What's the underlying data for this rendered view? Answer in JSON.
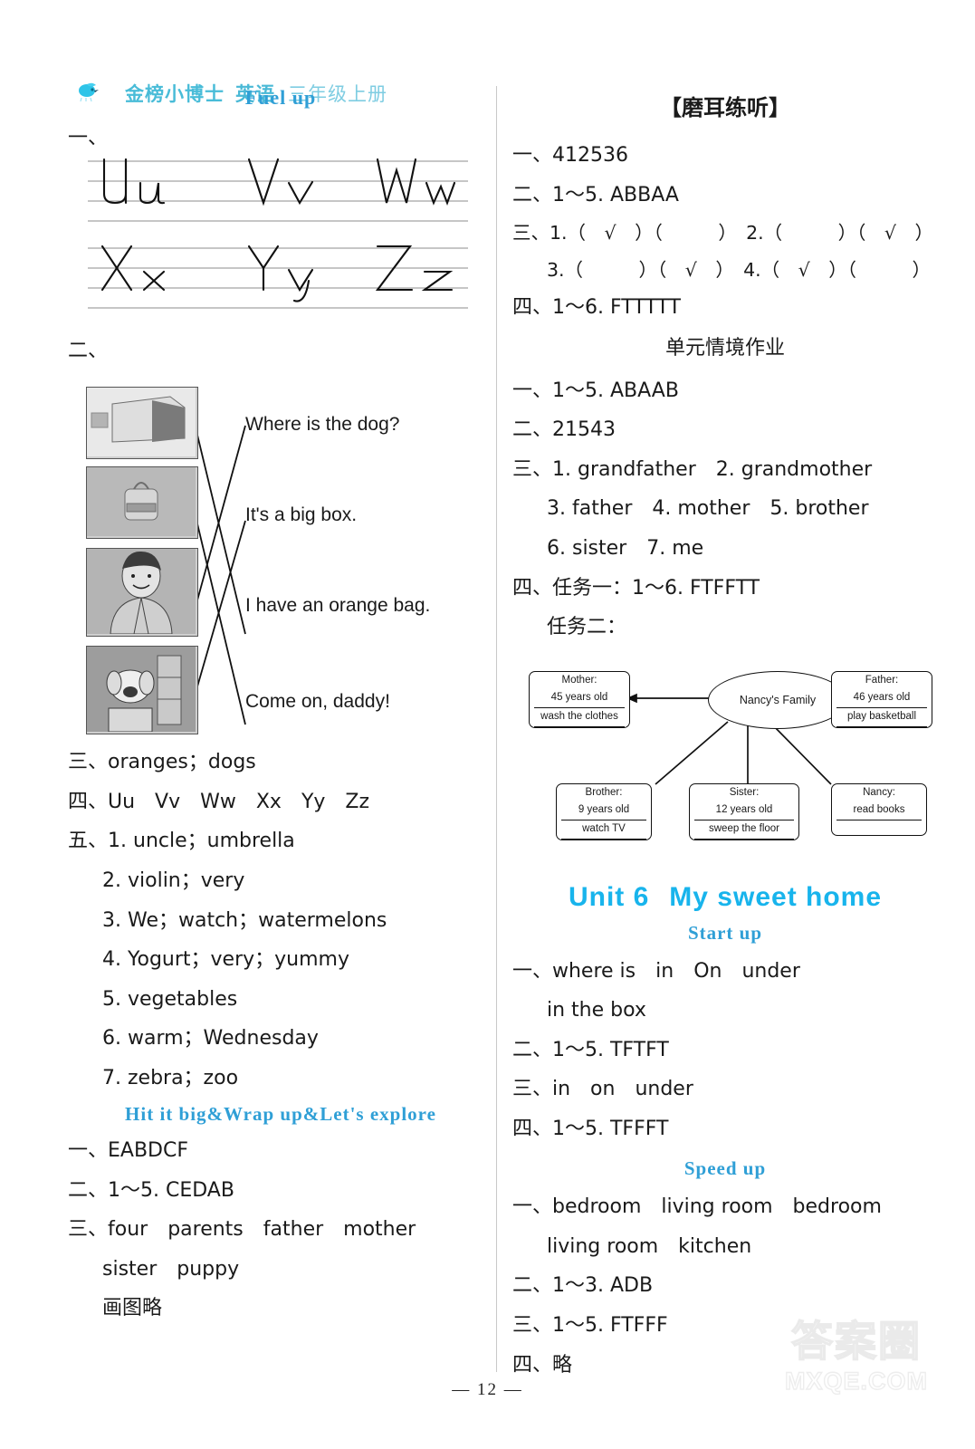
{
  "header": {
    "logo_icon": "bird-logo-icon",
    "brand": "金榜小博士",
    "subject": "英语",
    "grade": "三年级上册"
  },
  "page_footer": {
    "page_number": "— 12 —",
    "watermark_cn": "答案圈",
    "watermark_en": "MXQE.COM"
  },
  "left_column": {
    "section_title": "Fuel up",
    "q1": {
      "marker": "一、",
      "rows": [
        {
          "letters": [
            "Uu",
            "Vv",
            "Ww"
          ]
        },
        {
          "letters": [
            "Xx",
            "Yy",
            "Zz"
          ]
        }
      ]
    },
    "q2": {
      "marker": "二、",
      "pictures": [
        "big-box-photo",
        "orange-backpack-photo",
        "dad-illustration",
        "dog-in-kitchen-photo"
      ],
      "sentences": [
        "Where is the dog?",
        "It's a big box.",
        "I have an orange bag.",
        "Come on, daddy!"
      ]
    },
    "q3": "三、oranges；dogs",
    "q4": "四、Uu　Vv　Ww　Xx　Yy　Zz",
    "q5": {
      "marker": "五、",
      "items": [
        "1. uncle；umbrella",
        "2. violin；very",
        "3. We；watch；watermelons",
        "4. Yogurt；very；yummy",
        "5. vegetables",
        "6. warm；Wednesday",
        "7. zebra；zoo"
      ]
    },
    "section2_title": "Hit it big&Wrap up&Let's explore",
    "s2_q1": "一、EABDCF",
    "s2_q2": "二、1～5. CEDAB",
    "s2_q3_line1": "三、four　parents　father　mother",
    "s2_q3_line2": "sister　puppy",
    "s2_q3_line3": "画图略"
  },
  "right_column": {
    "listening_title": "【磨耳练听】",
    "l_q1": "一、412536",
    "l_q2": "二、1～5. ABBAA",
    "l_q3_line1": "三、1.（　√　）（　　　）　2.（　　　）（　√　）",
    "l_q3_line2": "3.（　　　）（　√　）　4.（　√　）（　　　）",
    "l_q4": "四、1～6. FTTTTT",
    "unit_task_title": "单元情境作业",
    "t_q1": "一、1～5. ABAAB",
    "t_q2": "二、21543",
    "t_q3_line1": "三、1. grandfather　2. grandmother",
    "t_q3_line2": "3. father　4. mother　5. brother",
    "t_q3_line3": "6. sister　7. me",
    "t_q4_line1": "四、任务一：1～6. FTFFTT",
    "t_q4_line2": "任务二：",
    "family_chart": {
      "center": "Nancy's Family",
      "nodes": [
        {
          "name": "mother-node",
          "title": "Mother:",
          "age": "45 years old",
          "activity": "wash the clothes"
        },
        {
          "name": "father-node",
          "title": "Father:",
          "age": "46 years old",
          "activity": "play basketball"
        },
        {
          "name": "brother-node",
          "title": "Brother:",
          "age": "9 years old",
          "activity": "watch TV"
        },
        {
          "name": "sister-node",
          "title": "Sister:",
          "age": "12 years old",
          "activity": "sweep the floor"
        },
        {
          "name": "nancy-node",
          "title": "Nancy:",
          "age": "read books",
          "activity": ""
        }
      ]
    },
    "unit6_number": "Unit 6",
    "unit6_name": "My sweet home",
    "startup_title": "Start up",
    "su_q1_line1": "一、where is　in　On　under",
    "su_q1_line2": "in the box",
    "su_q2": "二、1～5. TFTFT",
    "su_q3": "三、in　on　under",
    "su_q4": "四、1～5. TFFFT",
    "speedup_title": "Speed up",
    "sp_q1_line1": "一、bedroom　living room　bedroom",
    "sp_q1_line2": "living room　kitchen",
    "sp_q2": "二、1～3. ADB",
    "sp_q3": "三、1～5. FTFFF",
    "sp_q4": "四、略"
  }
}
